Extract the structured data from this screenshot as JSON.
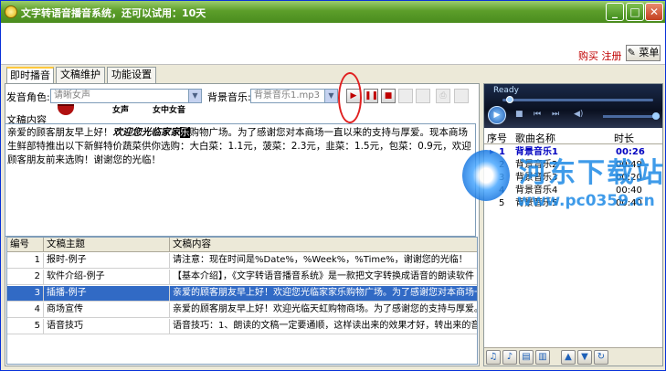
{
  "window": {
    "title": "文字转语音播音系统，还可以试用：10天",
    "minimize_glyph": "_",
    "maximize_glyph": "□",
    "close_glyph": "✕"
  },
  "header": {
    "buy_register": "购买 注册",
    "menu_label": "菜单"
  },
  "tabs": [
    {
      "label": "即时播音",
      "active": true
    },
    {
      "label": "文稿维护",
      "active": false
    },
    {
      "label": "功能设置",
      "active": false
    }
  ],
  "voice": {
    "label": "发音角色:",
    "value": "请晰女声"
  },
  "music": {
    "label": "背景音乐:",
    "value": "背景音乐1.mp3"
  },
  "voice_icons": [
    "女声",
    "女中女音"
  ],
  "script_label": "文稿内容",
  "script_text": {
    "part1": "亲爱的顾客朋友早上好！",
    "italic": "欢迎您光临家家",
    "selected": "乐",
    "part2": "购物广场。为了感谢您对本商场一直以来的支持与厚爱。现本商场生鲜部特推出以下新鲜特价蔬菜供你选购：大白菜：1.1元，菠菜：2.3元，韭菜：1.5元，包菜：0.9元，欢迎顾客朋友前来选购！谢谢您的光临！"
  },
  "table": {
    "headers": [
      "编号",
      "文稿主题",
      "文稿内容"
    ],
    "rows": [
      {
        "num": "1",
        "topic": "报时-例子",
        "content": "请注意：现在时间是%Date%，%Week%，%Time%，谢谢您的光临！",
        "selected": false
      },
      {
        "num": "2",
        "topic": "软件介绍-例子",
        "content": "【基本介绍】，《文字转语音播音系统》是一款把文字转换成语音的朗读软件",
        "selected": false
      },
      {
        "num": "3",
        "topic": "插播-例子",
        "content": "亲爱的顾客朋友早上好！欢迎您光临家家乐购物广场。为了感谢您对本商场一直",
        "selected": true
      },
      {
        "num": "4",
        "topic": "商场宣传",
        "content": "亲爱的顾客朋友早上好！欢迎光临天虹购物商场。为了感谢您的支持与厚爱。我",
        "selected": false
      },
      {
        "num": "5",
        "topic": "语音技巧",
        "content": "语音技巧：1、朗读的文稿一定要通顺，这样读出来的效果才好，转出来的音频",
        "selected": false
      }
    ]
  },
  "player": {
    "status": "Ready"
  },
  "playlist": {
    "headers": [
      "序号",
      "歌曲名称",
      "时长"
    ],
    "rows": [
      {
        "marker": "▸",
        "num": "1",
        "name": "背景音乐1",
        "duration": "00:26",
        "current": true
      },
      {
        "marker": "",
        "num": "2",
        "name": "背景音乐2",
        "duration": "00:49",
        "current": false
      },
      {
        "marker": "",
        "num": "3",
        "name": "背景音乐3",
        "duration": "00:20",
        "current": false
      },
      {
        "marker": "",
        "num": "4",
        "name": "背景音乐4",
        "duration": "00:40",
        "current": false
      },
      {
        "marker": "",
        "num": "5",
        "name": "背景音乐5",
        "duration": "00:40",
        "current": false
      }
    ]
  },
  "watermark": {
    "text": "河东下载站",
    "url": "www.pc0359.cn"
  },
  "colors": {
    "titlebar": "#5c9e2a",
    "selection": "#316ac5",
    "accent_red": "#c00000",
    "playlist_current": "#0000c0"
  }
}
